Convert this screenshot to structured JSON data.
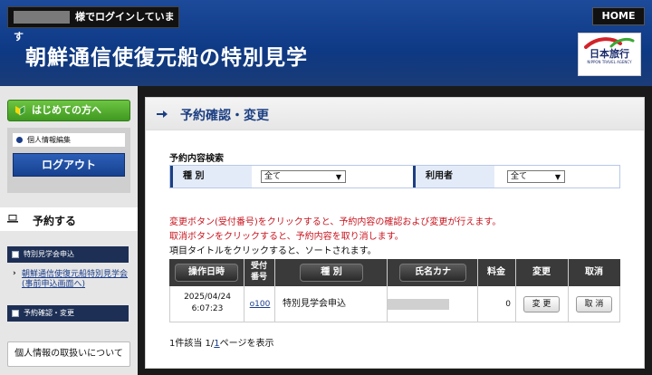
{
  "header": {
    "login_status": "様でログインしています",
    "home_label": "HOME",
    "site_title": "朝鮮通信使復元船の特別見学",
    "logo_name": "日本旅行",
    "logo_subtitle": "NIPPON TRAVEL AGENCY",
    "logo_colors": {
      "red": "#d2232a",
      "green": "#3aa935",
      "navy": "#1a2a6a"
    }
  },
  "sidebar": {
    "intro_button": "はじめての方へ",
    "profile_edit": "個人情報編集",
    "logout_button": "ログアウト",
    "reserve_section": "予約する",
    "nav_special": "特別見学会申込",
    "nav_sub_link": "朝鮮通信使復元船特別見学会(事前申込画面へ)",
    "nav_confirm": "予約確認・変更",
    "privacy_button": "個人情報の取扱いについて"
  },
  "main": {
    "page_title": "予約確認・変更",
    "search": {
      "title": "予約内容検索",
      "kind_label": "種 別",
      "kind_value": "全て",
      "user_label": "利用者",
      "user_value": "全て"
    },
    "notices": [
      "変更ボタン(受付番号)をクリックすると、予約内容の確認および変更が行えます。",
      "取消ボタンをクリックすると、予約内容を取り消します。",
      "項目タイトルをクリックすると、ソートされます。"
    ],
    "table": {
      "headers": {
        "date": "操作日時",
        "num_line1": "受付",
        "num_line2": "番号",
        "kind": "種 別",
        "name": "氏名カナ",
        "fee": "料金",
        "change": "変更",
        "cancel": "取消"
      },
      "rows": [
        {
          "date": "2025/04/24",
          "time": "6:07:23",
          "num": "o100",
          "kind": "特別見学会申込",
          "fee": "0",
          "change_label": "変 更",
          "cancel_label": "取 消"
        }
      ]
    },
    "result_count_prefix": "1件該当 1/",
    "result_count_page": "1",
    "result_count_suffix": "ページを表示"
  }
}
